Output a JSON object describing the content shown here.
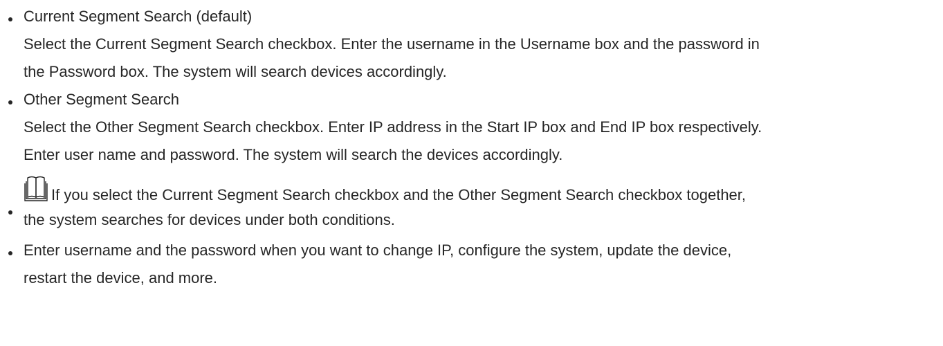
{
  "bullets": [
    {
      "title": "Current Segment Search (default)",
      "lines": [
        "Select the Current Segment Search checkbox. Enter the username in the Username box and the password in",
        "the Password box. The system will search devices accordingly."
      ]
    },
    {
      "title": "Other Segment Search",
      "lines": [
        "Select the Other Segment Search checkbox. Enter IP address in the Start IP box and End IP box respectively.",
        "Enter user name and password. The system will search the devices accordingly."
      ]
    },
    {
      "icon": "book-note-icon",
      "lines": [
        "If you select the Current Segment Search checkbox and the Other Segment Search checkbox together,",
        "the system searches for devices under both conditions."
      ]
    },
    {
      "lines": [
        "Enter username and the password when you want to change IP, configure the system, update the device,",
        "restart the device, and more."
      ]
    }
  ]
}
